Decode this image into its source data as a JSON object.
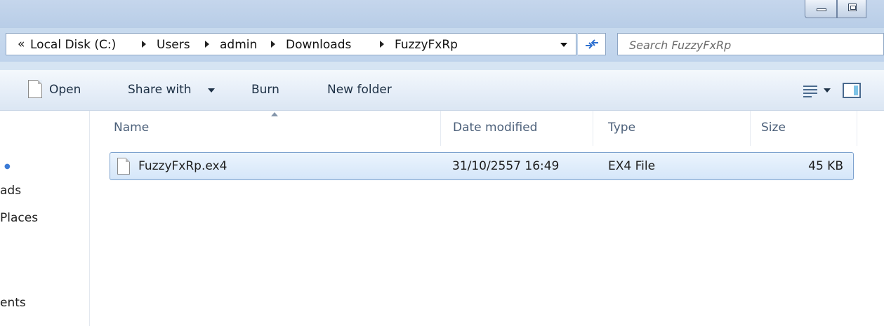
{
  "address": {
    "overflow": "«",
    "crumbs": [
      "Local Disk (C:)",
      "Users",
      "admin",
      "Downloads",
      "FuzzyFxRp"
    ]
  },
  "search": {
    "placeholder": "Search FuzzyFxRp"
  },
  "toolbar": {
    "open_label": "Open",
    "share_label": "Share with",
    "burn_label": "Burn",
    "new_folder_label": "New folder"
  },
  "nav": {
    "items": [
      "ads",
      "Places",
      "ents"
    ]
  },
  "columns": {
    "name": "Name",
    "date": "Date modified",
    "type": "Type",
    "size": "Size"
  },
  "files": [
    {
      "name": "FuzzyFxRp.ex4",
      "date": "31/10/2557 16:49",
      "type": "EX4 File",
      "size": "45 KB"
    }
  ],
  "colors": {
    "selection": "#d5e6f9",
    "selection_border": "#7da2ce",
    "chrome": "#c5d6ec"
  },
  "icons": [
    "minimize-icon",
    "maximize-icon",
    "refresh-icon",
    "document-icon",
    "views-icon",
    "preview-pane-icon",
    "file-icon"
  ]
}
